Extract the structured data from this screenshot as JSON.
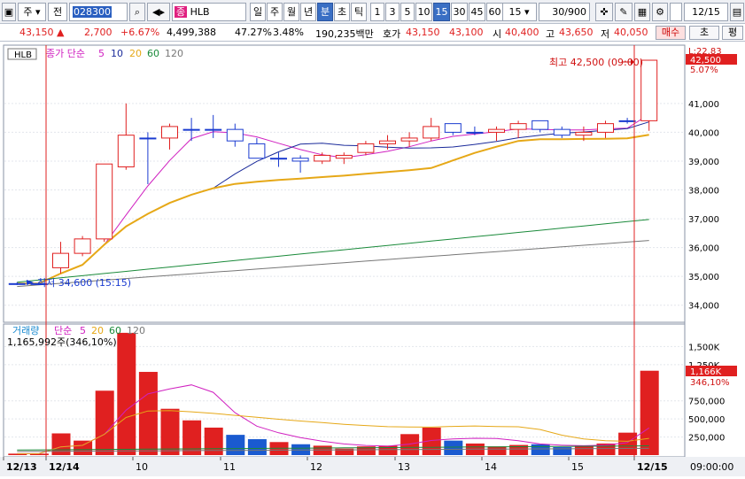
{
  "toolbar": {
    "market_label": "주",
    "type_label": "전",
    "code_value": "028300",
    "stock_name": "HLB",
    "stock_tag": "종",
    "period_tabs": [
      "일",
      "주",
      "월",
      "년",
      "분",
      "초",
      "틱"
    ],
    "active_period": "분",
    "intervals": [
      "1",
      "3",
      "5",
      "10",
      "15",
      "30",
      "45",
      "60"
    ],
    "active_interval": "15",
    "interval_select": "15",
    "count_display": "30/900",
    "date_value": "12/15"
  },
  "infobar": {
    "price": "43,150",
    "change": "2,700",
    "change_pct": "+6.67%",
    "volume": "4,499,388",
    "ratio1": "47.27%",
    "ratio2": "3.48%",
    "amount": "190,235백만",
    "ask_label": "호가",
    "ask": "43,150",
    "bid": "43,100",
    "open_label": "시",
    "open": "40,400",
    "high_label": "고",
    "high": "43,650",
    "low_label": "저",
    "low": "40,050",
    "buy_btn": "매수",
    "eval_btn": "평"
  },
  "price_panel": {
    "symbol_tag": "HLB",
    "legend_prefix": "종가 단순",
    "ma_periods": [
      "5",
      "10",
      "20",
      "60",
      "120"
    ],
    "ma_colors": [
      "#d020c0",
      "#1a2a9a",
      "#e6a817",
      "#1a8a3a",
      "#777777"
    ],
    "high_label": "최고 42,500 (09:00)",
    "low_label": "최저 34,600 (15:15)",
    "current_price_tag": "42,500",
    "current_pct_tag": "5.07%",
    "top_tag": "L:22.83",
    "y_ticks": [
      "41,000",
      "40,000",
      "39,000",
      "38,000",
      "37,000",
      "36,000",
      "35,000",
      "34,000"
    ]
  },
  "volume_panel": {
    "title": "거래량",
    "legend_prefix": "단순",
    "ma_periods": [
      "5",
      "20",
      "60",
      "120"
    ],
    "current_value": "1,165,992주(346,10%)",
    "tag_value": "1,166K",
    "tag_pct": "346,10%",
    "y_ticks": [
      "1,500K",
      "1,250K",
      "750,000",
      "500,000",
      "250,000"
    ]
  },
  "x_axis": {
    "labels": [
      "12/13",
      "12/14",
      "10",
      "11",
      "12",
      "13",
      "14",
      "15",
      "12/15"
    ],
    "time": "09:00:00"
  },
  "chart_data": {
    "type": "candlestick",
    "price_range": [
      33500,
      42900
    ],
    "candles": [
      {
        "o": 34750,
        "h": 34800,
        "l": 34700,
        "c": 34750
      },
      {
        "o": 34750,
        "h": 34800,
        "l": 34700,
        "c": 34750
      },
      {
        "o": 35300,
        "h": 36200,
        "l": 35100,
        "c": 35800
      },
      {
        "o": 35800,
        "h": 36400,
        "l": 35700,
        "c": 36300
      },
      {
        "o": 36300,
        "h": 38900,
        "l": 36200,
        "c": 38900
      },
      {
        "o": 38800,
        "h": 41000,
        "l": 38700,
        "c": 39900
      },
      {
        "o": 39800,
        "h": 40000,
        "l": 38200,
        "c": 39800
      },
      {
        "o": 39800,
        "h": 40300,
        "l": 39400,
        "c": 40200
      },
      {
        "o": 40100,
        "h": 40500,
        "l": 39700,
        "c": 40100
      },
      {
        "o": 40100,
        "h": 40600,
        "l": 39800,
        "c": 40100
      },
      {
        "o": 40100,
        "h": 40300,
        "l": 39500,
        "c": 39700
      },
      {
        "o": 39600,
        "h": 39800,
        "l": 39100,
        "c": 39100
      },
      {
        "o": 39100,
        "h": 39300,
        "l": 38800,
        "c": 39100
      },
      {
        "o": 39100,
        "h": 39200,
        "l": 38600,
        "c": 39000
      },
      {
        "o": 39000,
        "h": 39300,
        "l": 38900,
        "c": 39200
      },
      {
        "o": 39100,
        "h": 39300,
        "l": 38900,
        "c": 39200
      },
      {
        "o": 39300,
        "h": 39700,
        "l": 39200,
        "c": 39600
      },
      {
        "o": 39600,
        "h": 39900,
        "l": 39400,
        "c": 39700
      },
      {
        "o": 39700,
        "h": 40000,
        "l": 39500,
        "c": 39800
      },
      {
        "o": 39800,
        "h": 40500,
        "l": 39700,
        "c": 40200
      },
      {
        "o": 40300,
        "h": 40300,
        "l": 39900,
        "c": 40000
      },
      {
        "o": 40000,
        "h": 40200,
        "l": 39900,
        "c": 40000
      },
      {
        "o": 40000,
        "h": 40200,
        "l": 39700,
        "c": 40100
      },
      {
        "o": 40100,
        "h": 40400,
        "l": 39800,
        "c": 40300
      },
      {
        "o": 40400,
        "h": 40400,
        "l": 40000,
        "c": 40100
      },
      {
        "o": 40100,
        "h": 40200,
        "l": 39800,
        "c": 39900
      },
      {
        "o": 39900,
        "h": 40200,
        "l": 39700,
        "c": 40000
      },
      {
        "o": 40000,
        "h": 40400,
        "l": 39800,
        "c": 40300
      },
      {
        "o": 40400,
        "h": 40500,
        "l": 40300,
        "c": 40400
      },
      {
        "o": 40400,
        "h": 42500,
        "l": 40050,
        "c": 42500
      }
    ],
    "volume_range": [
      0,
      1750000
    ],
    "volumes": [
      20000,
      20000,
      300000,
      200000,
      890000,
      1690000,
      1150000,
      640000,
      480000,
      380000,
      280000,
      220000,
      180000,
      150000,
      130000,
      90000,
      120000,
      130000,
      290000,
      380000,
      200000,
      160000,
      120000,
      140000,
      150000,
      110000,
      130000,
      160000,
      310000,
      1166000
    ]
  }
}
